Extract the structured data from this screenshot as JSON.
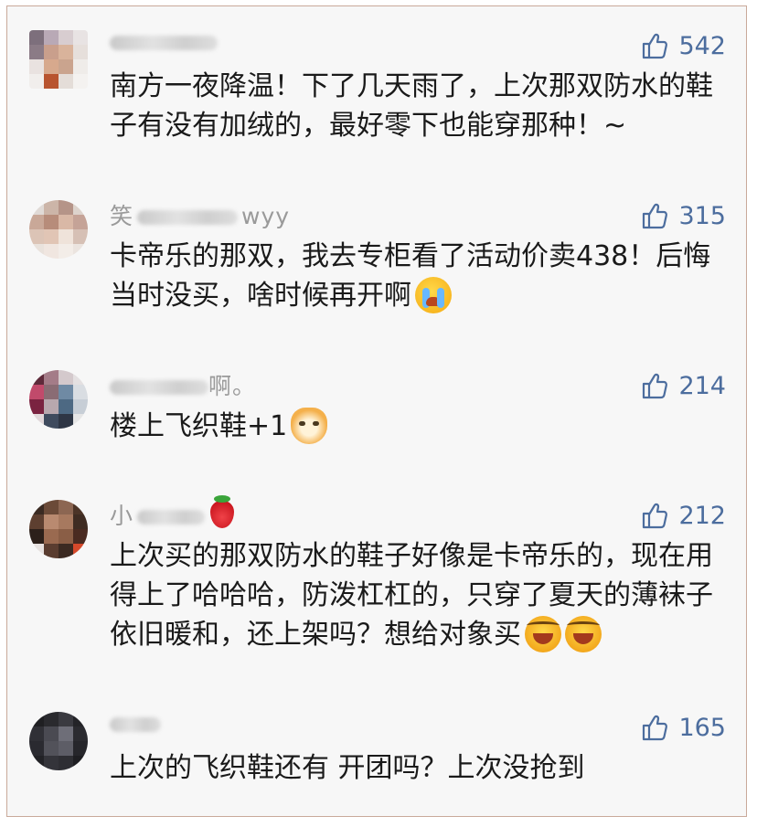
{
  "comments": [
    {
      "name": "大美熊猫",
      "likes": "542",
      "text": "南方一夜降温！下了几天雨了，上次那双防水的鞋子有没有加绒的，最好零下也能穿那种！~",
      "emoji": null
    },
    {
      "name": "笑眼弯弯wyy",
      "likes": "315",
      "text": "卡帝乐的那双，我去专柜看了活动价卖438！后悔当时没买，啥时候再开啊",
      "emoji": "crying-face"
    },
    {
      "name": "静静啊。",
      "likes": "214",
      "text": "楼上飞织鞋+1",
      "emoji": "doge-face"
    },
    {
      "name": "小草莓",
      "likes": "212",
      "text": "上次买的那双防水的鞋子好像是卡帝乐的，现在用得上了哈哈哈，防泼杠杠的，只穿了夏天的薄袜子依旧暖和，还上架吗？想给对象买",
      "emoji": "laughing-face"
    },
    {
      "name": "阿薇",
      "likes": "165",
      "text": "上次的飞织鞋还有 开团吗？上次没抢到",
      "emoji": null
    }
  ],
  "colors": {
    "like_blue": "#4c6d9e",
    "name_gray": "#9a9a9a",
    "text": "#1a1a1a",
    "background": "#f7f7f7",
    "border": "#c9a99a"
  }
}
